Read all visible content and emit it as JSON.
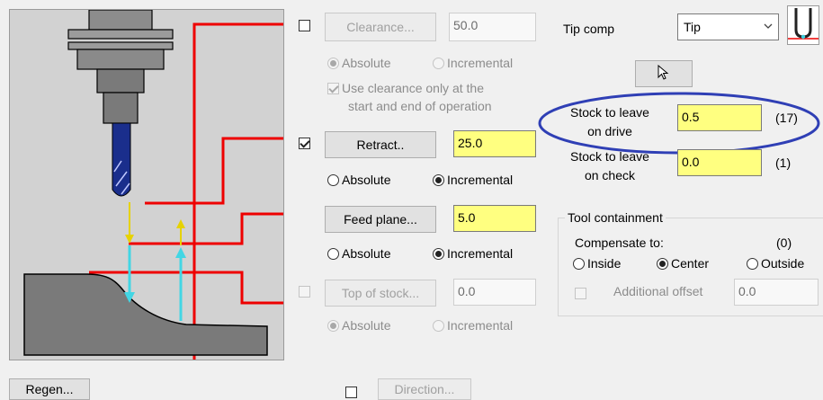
{
  "illustration": {
    "name": "clearance-plane-diagram"
  },
  "clearance": {
    "label": "Clearance...",
    "enabled": false,
    "value": "50.0",
    "absolute_label": "Absolute",
    "incremental_label": "Incremental",
    "use_only_label_line1": "Use clearance only at the",
    "use_only_label_line2": "start and end of operation"
  },
  "retract": {
    "label": "Retract..",
    "enabled": true,
    "value": "25.0",
    "absolute_label": "Absolute",
    "incremental_label": "Incremental"
  },
  "feed_plane": {
    "label": "Feed plane...",
    "value": "5.0",
    "absolute_label": "Absolute",
    "incremental_label": "Incremental"
  },
  "top_of_stock": {
    "label": "Top of stock...",
    "enabled": false,
    "value": "0.0",
    "absolute_label": "Absolute",
    "incremental_label": "Incremental"
  },
  "tip_comp": {
    "label": "Tip comp",
    "selected": "Tip"
  },
  "stock_drive": {
    "label_line1": "Stock to leave",
    "label_line2": "on drive",
    "value": "0.5",
    "note": "(17)"
  },
  "stock_check": {
    "label_line1": "Stock to leave",
    "label_line2": "on check",
    "value": "0.0",
    "note": "(1)"
  },
  "tool_containment": {
    "title": "Tool containment",
    "compensate_label": "Compensate to:",
    "compensate_note": "(0)",
    "inside_label": "Inside",
    "center_label": "Center",
    "outside_label": "Outside",
    "selected": "Center",
    "additional_offset_label": "Additional offset",
    "additional_offset_value": "0.0"
  },
  "regen": {
    "label": "Regen..."
  },
  "direction": {
    "label": "Direction...",
    "enabled": false
  },
  "colors": {
    "highlight_field": "#ffff80",
    "annotation_ellipse": "#2f3fb5",
    "plane_line": "#ff0000"
  }
}
